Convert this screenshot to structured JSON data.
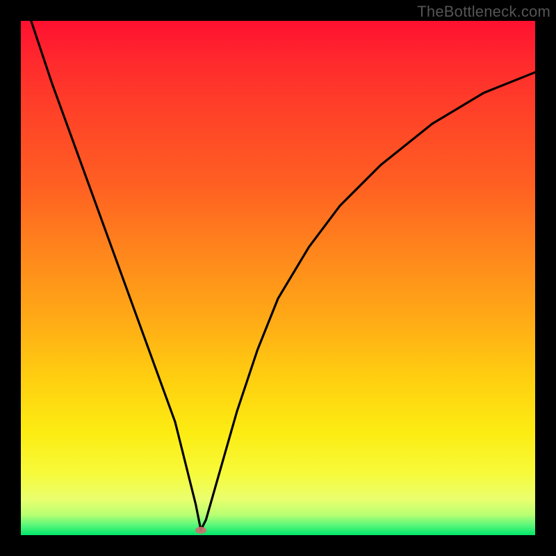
{
  "watermark": "TheBottleneck.com",
  "chart_data": {
    "type": "line",
    "title": "",
    "xlabel": "",
    "ylabel": "",
    "xlim": [
      0,
      100
    ],
    "ylim": [
      0,
      100
    ],
    "grid": false,
    "background": "red-yellow-green vertical gradient",
    "series": [
      {
        "name": "curve",
        "x": [
          2,
          6,
          10,
          14,
          18,
          22,
          26,
          30,
          32,
          34,
          35,
          36,
          38,
          42,
          46,
          50,
          56,
          62,
          70,
          80,
          90,
          100
        ],
        "values": [
          100,
          88,
          77,
          66,
          55,
          44,
          33,
          22,
          14,
          6,
          1,
          3,
          10,
          24,
          36,
          46,
          56,
          64,
          72,
          80,
          86,
          90
        ]
      }
    ],
    "marker": {
      "x": 35,
      "y": 1
    }
  }
}
